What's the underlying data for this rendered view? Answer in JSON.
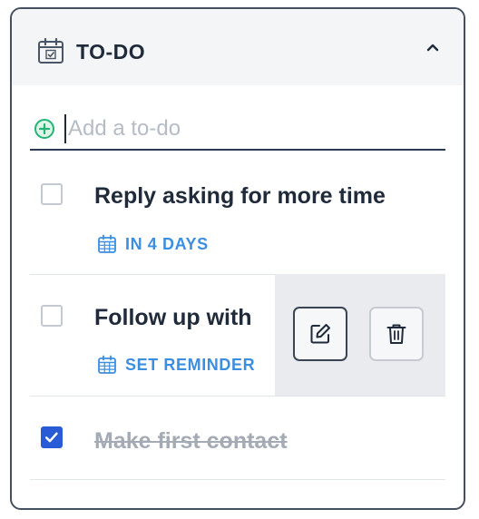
{
  "header": {
    "title": "TO-DO",
    "icon": "calendar-check-icon",
    "toggle_icon": "chevron-up-icon"
  },
  "add_todo": {
    "placeholder": "Add a to-do",
    "value": "",
    "icon": "plus-circle-icon"
  },
  "todos": [
    {
      "title": "Reply asking for more time",
      "completed": false,
      "due_label": "IN 4 DAYS",
      "due_icon": "calendar-icon"
    },
    {
      "title": "Follow up with",
      "completed": false,
      "due_label": "SET REMINDER",
      "due_icon": "calendar-icon",
      "actions": [
        "edit-icon",
        "trash-icon"
      ]
    },
    {
      "title": "Make first contact",
      "completed": true
    }
  ],
  "colors": {
    "accent": "#2a5bd7",
    "link": "#3b8ee0",
    "add_icon": "#22b573",
    "text": "#1f2a3a",
    "muted": "#a5abb5"
  }
}
